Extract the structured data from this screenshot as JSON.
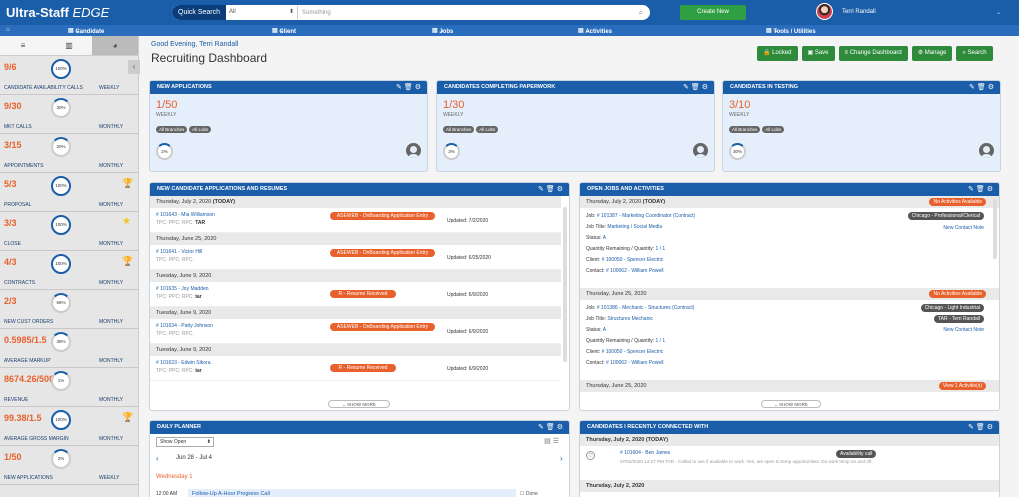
{
  "app": {
    "title": "Ultra-Staff",
    "title_italic": "EDGE"
  },
  "top": {
    "quick_search": "Quick Search",
    "search_scope": "All",
    "search_placeholder": "Something",
    "create_new": "Create New",
    "user_name": "Terri Randall"
  },
  "nav": {
    "home_icon": "home-icon",
    "items": [
      "Candidate",
      "Client",
      "Jobs",
      "Activities",
      "Tools / Utilities"
    ]
  },
  "sidebar": {
    "kpis": [
      {
        "value": "9/6",
        "pct": "100%",
        "name": "CANDIDATE AVAILABILITY CALLS",
        "period": "WEEKLY",
        "badge": ""
      },
      {
        "value": "9/30",
        "pct": "30%",
        "name": "MKT CALLS",
        "period": "MONTHLY",
        "badge": ""
      },
      {
        "value": "3/15",
        "pct": "20%",
        "name": "APPOINTMENTS",
        "period": "MONTHLY",
        "badge": ""
      },
      {
        "value": "5/3",
        "pct": "100%",
        "name": "PROPOSAL",
        "period": "MONTHLY",
        "badge": "trophy"
      },
      {
        "value": "3/3",
        "pct": "100%",
        "name": "CLOSE",
        "period": "MONTHLY",
        "badge": "star"
      },
      {
        "value": "4/3",
        "pct": "100%",
        "name": "CONTRACTS",
        "period": "MONTHLY",
        "badge": "trophy"
      },
      {
        "value": "2/3",
        "pct": "66%",
        "name": "NEW CUST ORDERS",
        "period": "MONTHLY",
        "badge": ""
      },
      {
        "value": "0.5985/1.5",
        "pct": "39%",
        "name": "AVERAGE MARKUP",
        "period": "MONTHLY",
        "badge": ""
      },
      {
        "value": "8674.26/500",
        "pct": "1%",
        "name": "REVENUE",
        "period": "MONTHLY",
        "badge": ""
      },
      {
        "value": "99.38/1.5",
        "pct": "100%",
        "name": "AVERAGE GROSS MARGIN",
        "period": "MONTHLY",
        "badge": "trophy"
      },
      {
        "value": "1/50",
        "pct": "2%",
        "name": "NEW APPLICATIONS",
        "period": "WEEKLY",
        "badge": ""
      }
    ]
  },
  "header": {
    "greeting": "Good Evening, Terri Randall",
    "title": "Recruiting Dashboard",
    "buttons": [
      "Locked",
      "Save",
      "Change Dashboard",
      "Manage",
      "Search"
    ]
  },
  "summary": [
    {
      "title": "NEW APPLICATIONS",
      "value": "1/50",
      "period": "WEEKLY",
      "pct": "2%"
    },
    {
      "title": "CANDIDATES COMPLETING PAPERWORK",
      "value": "1/30",
      "period": "WEEKLY",
      "pct": "3%"
    },
    {
      "title": "CANDIDATES IN TESTING",
      "value": "3/10",
      "period": "WEEKLY",
      "pct": "30%"
    }
  ],
  "chips": [
    "All Branches",
    "All Lobs"
  ],
  "applications": {
    "title": "NEW CANDIDATE APPLICATIONS AND RESUMES",
    "groups": [
      {
        "date": "Thursday, July 2, 2020",
        "today": "(TODAY)",
        "id": "# 101643 - Mia Williamson",
        "tpc": "TPC: PPC: RPC:",
        "tpc_b": "TAR",
        "status": "ASEWEB - OnBoarding Application Entry",
        "updated": "Updated: 7/2/2020"
      },
      {
        "date": "Thursday, June 25, 2020",
        "today": "",
        "id": "# 101641 - Victor Hill",
        "tpc": "TPC: PPC: RPC:",
        "tpc_b": "",
        "status": "ASEWEB - OnBoarding Application Entry",
        "updated": "Updated: 6/25/2020"
      },
      {
        "date": "Tuesday, June 9, 2020",
        "today": "",
        "id": "# 101635 - Joy Madden",
        "tpc": "TPC: PPC: RPC:",
        "tpc_b": "tar",
        "status": "R - Resume Received",
        "updated": "Updated: 6/9/2020"
      },
      {
        "date": "Tuesday, June 9, 2020",
        "today": "",
        "id": "# 101634 - Patty Johnson",
        "tpc": "TPC: PPC: RPC:",
        "tpc_b": "",
        "status": "ASEWEB - OnBoarding Application Entry",
        "updated": "Updated: 6/9/2020"
      },
      {
        "date": "Tuesday, June 9, 2020",
        "today": "",
        "id": "# 101633 - Edwin Sikora",
        "tpc": "TPC: PPC: RPC:",
        "tpc_b": "tar",
        "status": "R - Resume Received",
        "updated": "Updated: 6/9/2020"
      }
    ],
    "show_more": "SHOW MORE"
  },
  "jobs": {
    "title": "OPEN JOBS AND ACTIVITIES",
    "no_act": "No Activities Available",
    "view_act": "View 1 Activitie(s)",
    "list": [
      {
        "date": "Thursday, July 2, 2020",
        "today": "(TODAY)",
        "job": "# 101387 - Marketing Coordinator (Contract)",
        "job_title": "Marketing / Social Media",
        "status": "A",
        "qty": "1 / 1",
        "client": "# 100050 - Spencer Electric",
        "contact": "# 100062 - William Powell",
        "tag1": "Chicago - Professional/Clerical",
        "tag2": "",
        "new_contact": "New Contact Note"
      },
      {
        "date": "Thursday, June 25, 2020",
        "today": "",
        "job": "# 101386 - Mechanic - Structures (Contract)",
        "job_title": "Structures Mechanic",
        "status": "A",
        "qty": "1 / 1",
        "client": "# 100050 - Spencer Electric",
        "contact": "# 100062 - William Powell",
        "tag1": "Chicago - Light Industrial",
        "tag2": "TAR - Terri Randall",
        "new_contact": "New Contact Note"
      }
    ],
    "labels": {
      "job": "Job:",
      "job_title": "Job Title:",
      "status": "Status:",
      "qty": "Quantity Remaining / Quantity:",
      "client": "Client:",
      "contact": "Contact:"
    },
    "third_date": "Thursday, June 25, 2020",
    "show_more": "SHOW MORE"
  },
  "planner": {
    "title": "DAILY PLANNER",
    "filter": "Show Open",
    "range": "Jun 28 - Jul 4",
    "day": "Wednesday 1",
    "time": "12:00 AM",
    "task": "Follow-Up A-Hour Progress Call",
    "done": "Done"
  },
  "connected": {
    "title": "CANDIDATES I RECENTLY CONNECTED WITH",
    "date1": "Thursday, July 2, 2020",
    "today": "(TODAY)",
    "cand": "# 101604 - Ben James",
    "note": "07/02/2020 12:27 PM TAR - Called to see if available to work. Yes, are open to temp opportunities. Do work temp on and off.",
    "tag": "Availability call",
    "date2": "Thursday, July 2, 2020"
  }
}
